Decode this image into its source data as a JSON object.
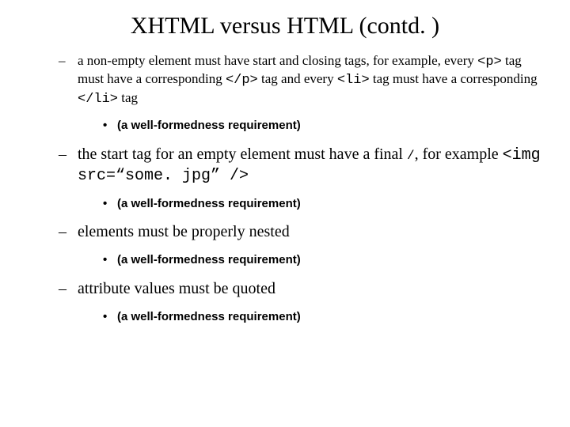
{
  "title": "XHTML versus HTML (contd. )",
  "bullets": [
    {
      "pre1": "a non-empty element must have start and closing tags, for example, every ",
      "code1": "<p>",
      "mid1": " tag must have a corresponding ",
      "code2": "</p>",
      "mid2": " tag and every ",
      "code3": "<li>",
      "mid3": " tag must have a corresponding ",
      "code4": "</li>",
      "post": " tag",
      "sub": "(a well-formedness requirement)"
    },
    {
      "pre1": "the start tag for an empty element must have a final ",
      "slash": "/",
      "mid1": ", for example ",
      "code1": "<img src=“some. jpg” />",
      "sub": "(a well-formedness requirement)"
    },
    {
      "text": "elements must be properly nested",
      "sub": "(a well-formedness requirement)"
    },
    {
      "text": "attribute values must be quoted",
      "sub": "(a well-formedness requirement)"
    }
  ]
}
